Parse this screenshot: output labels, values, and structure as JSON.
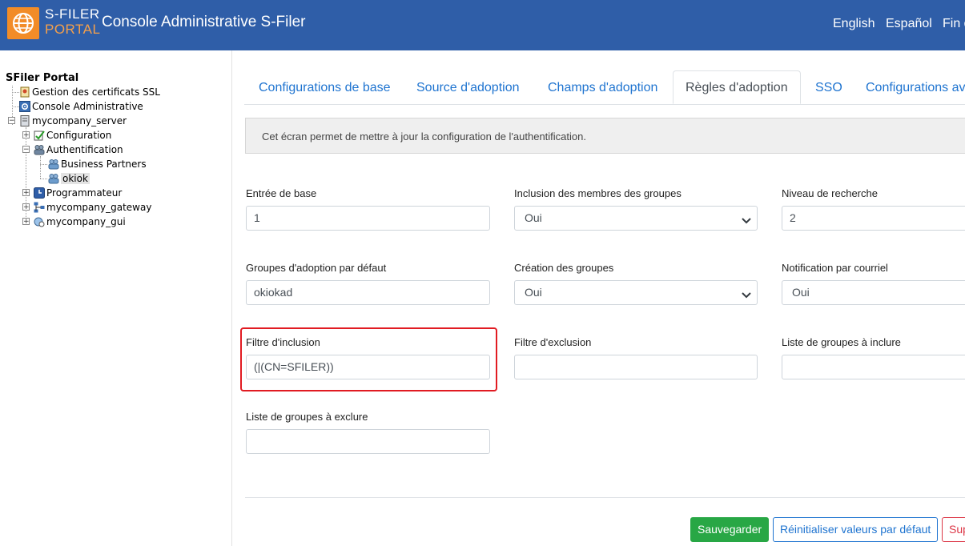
{
  "header": {
    "logo_line1": "S-FILER",
    "logo_line2": "PORTAL",
    "title": "Console Administrative S-Filer",
    "lang_en": "English",
    "lang_es": "Español",
    "lang_fin": "Fin d"
  },
  "tree": {
    "root": "SFiler Portal",
    "items": [
      {
        "label": "Gestion des certificats SSL"
      },
      {
        "label": "Console Administrative"
      },
      {
        "label": "mycompany_server"
      },
      {
        "label": "Configuration"
      },
      {
        "label": "Authentification"
      },
      {
        "label": "Business Partners"
      },
      {
        "label": "okiok"
      },
      {
        "label": "Programmateur"
      },
      {
        "label": "mycompany_gateway"
      },
      {
        "label": "mycompany_gui"
      }
    ]
  },
  "tabs": [
    {
      "label": "Configurations de base"
    },
    {
      "label": "Source d'adoption"
    },
    {
      "label": "Champs d'adoption"
    },
    {
      "label": "Règles d'adoption",
      "active": true
    },
    {
      "label": "SSO"
    },
    {
      "label": "Configurations av"
    }
  ],
  "info_text": "Cet écran permet de mettre à jour la configuration de l'authentification.",
  "form": {
    "entree_base": {
      "label": "Entrée de base",
      "value": "1"
    },
    "inclusion_membres": {
      "label": "Inclusion des membres des groupes",
      "value": "Oui"
    },
    "niveau_recherche": {
      "label": "Niveau de recherche",
      "value": "2"
    },
    "groupes_defaut": {
      "label": "Groupes d'adoption par défaut",
      "value": "okiokad"
    },
    "creation_groupes": {
      "label": "Création des groupes",
      "value": "Oui"
    },
    "notification": {
      "label": "Notification par courriel",
      "value": "Oui"
    },
    "filtre_inclusion": {
      "label": "Filtre d'inclusion",
      "value": "(|(CN=SFILER))"
    },
    "filtre_exclusion": {
      "label": "Filtre d'exclusion",
      "value": ""
    },
    "groupes_inclure": {
      "label": "Liste de groupes à inclure",
      "value": ""
    },
    "groupes_exclure": {
      "label": "Liste de groupes à exclure",
      "value": ""
    }
  },
  "buttons": {
    "save": "Sauvegarder",
    "reset": "Réinitialiser valeurs par défaut",
    "delete": "Supprimer"
  },
  "colors": {
    "header_bg": "#2f5ea8",
    "logo_orange": "#f28c28",
    "link_blue": "#1f74d0",
    "save_green": "#28a745",
    "highlight_red": "#e11b22"
  }
}
